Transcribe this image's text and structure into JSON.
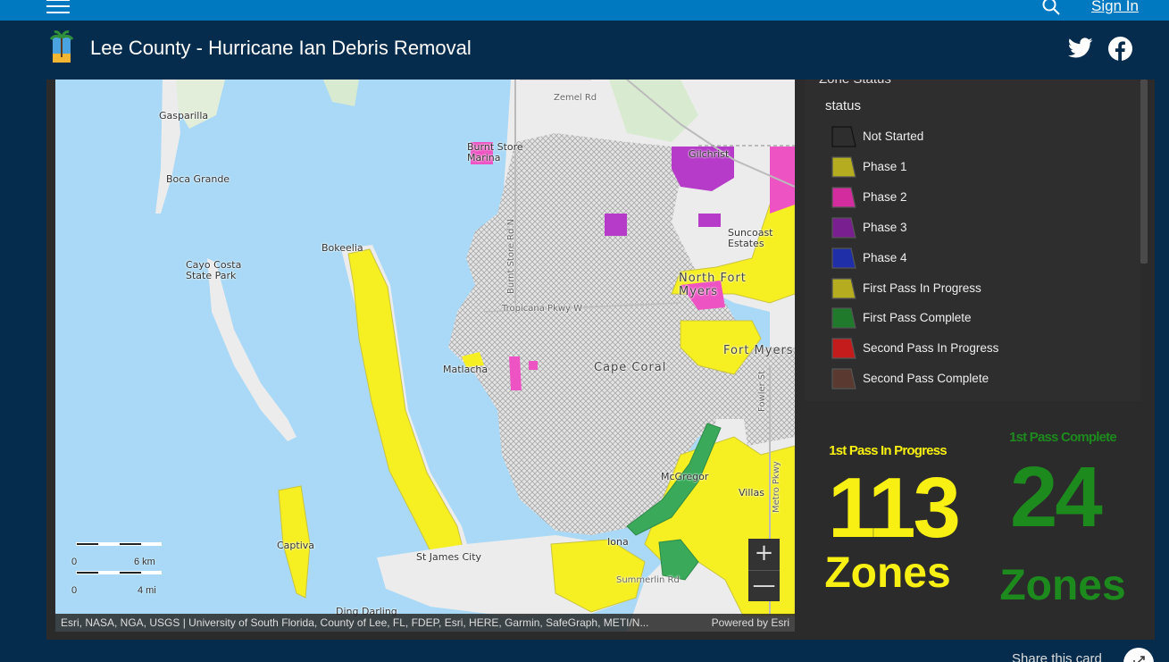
{
  "topbar": {
    "sign_in": "Sign In"
  },
  "header": {
    "title": "Lee County - Hurricane Ian Debris Removal"
  },
  "colors": {
    "topbar": "#0079c1",
    "header": "#062c4d",
    "water": "#a9d9f6",
    "land": "#ececec",
    "incorporated_hatch": "#c8c8c8",
    "first_pass_in_progress": "#f6f022",
    "phase_2": "#ee53c4",
    "phase_3": "#b53bc8",
    "first_pass_complete": "#3aaa5a",
    "card_yellow": "#f7f012",
    "card_green": "#1d8a1d"
  },
  "map": {
    "labels": {
      "gasparilla": "Gasparilla",
      "boca_grande": "Boca Grande",
      "cayo_costa": "Cayo Costa\nState Park",
      "bokeelia": "Bokeelia",
      "burnt_store_marina": "Burnt Store\nMarina",
      "zemel_rd": "Zemel Rd",
      "gilchrist": "Gilchrist",
      "suncoast_estates": "Suncoast\nEstates",
      "north_fort_myers": "North Fort\nMyers",
      "burnt_store_rd": "Burnt Store Rd N",
      "tropicana_pkwy": "Tropicana Pkwy W",
      "fort_myers": "Fort Myers",
      "matlacha": "Matlacha",
      "cape_coral": "Cape Coral",
      "fowler_st": "Fowler St",
      "mcgregor": "McGregor",
      "villas": "Villas",
      "metro_pkwy": "Metro Pkwy",
      "captiva": "Captiva",
      "st_james_city": "St James City",
      "iona": "Iona",
      "summerlin_rd": "Summerlin Rd",
      "ding_darling": "Ding Darling"
    },
    "scale": {
      "metric_zero": "0",
      "metric_max": "6 km",
      "imperial_zero": "0",
      "imperial_max": "4 mi"
    },
    "zoom_in": "+",
    "zoom_out": "—",
    "attribution": "Esri, NASA, NGA, USGS | University of South Florida, County of Lee, FL, FDEP, Esri, HERE, Garmin, SafeGraph, METI/N...",
    "powered_by": "Powered by Esri"
  },
  "legend": {
    "clipped_title": "Zone Status",
    "field": "status",
    "items": [
      {
        "label": "Not Started",
        "color": "#2e2e2e",
        "stroke": "#111111"
      },
      {
        "label": "Phase 1",
        "color": "#b5ad1f",
        "stroke": "#555555"
      },
      {
        "label": "Phase 2",
        "color": "#d22c9e",
        "stroke": "#555555"
      },
      {
        "label": "Phase 3",
        "color": "#7a1f8f",
        "stroke": "#555555"
      },
      {
        "label": "Phase 4",
        "color": "#1e2fa8",
        "stroke": "#555555"
      },
      {
        "label": "First Pass In Progress",
        "color": "#b5ad1f",
        "stroke": "#555555"
      },
      {
        "label": "First Pass Complete",
        "color": "#1f7a2c",
        "stroke": "#555555"
      },
      {
        "label": "Second Pass In Progress",
        "color": "#c41c1c",
        "stroke": "#555555"
      },
      {
        "label": "Second Pass Complete",
        "color": "#5a3a30",
        "stroke": "#555555"
      }
    ]
  },
  "cards": {
    "in_progress": {
      "title": "1st Pass In Progress",
      "value": "113",
      "unit": "Zones"
    },
    "complete": {
      "title": "1st Pass Complete",
      "value": "24",
      "unit": "Zones"
    }
  },
  "footer": {
    "share": "Share this card"
  }
}
